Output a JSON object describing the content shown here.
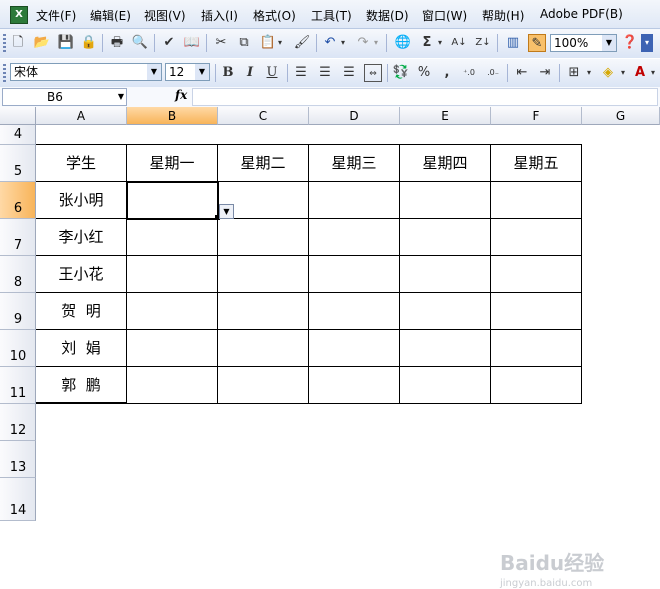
{
  "menubar": {
    "items": [
      "文件(F)",
      "编辑(E)",
      "视图(V)",
      "插入(I)",
      "格式(O)",
      "工具(T)",
      "数据(D)",
      "窗口(W)",
      "帮助(H)",
      "Adobe PDF(B)"
    ]
  },
  "toolbar": {
    "zoom_value": "100%",
    "icons": [
      "new-icon",
      "open-icon",
      "save-icon",
      "permission-icon",
      "print-icon",
      "print-preview-icon",
      "spelling-icon",
      "research-icon",
      "cut-icon",
      "copy-icon",
      "paste-icon",
      "format-painter-icon",
      "undo-icon",
      "redo-icon",
      "hyperlink-icon",
      "autosum-icon",
      "sort-ascending-icon",
      "sort-descending-icon",
      "chart-wizard-icon",
      "drawing-icon",
      "help-icon"
    ]
  },
  "format_toolbar": {
    "font_name": "宋体",
    "font_size": "12",
    "bold_label": "B",
    "italic_label": "I",
    "underline_label": "U",
    "percent_label": "%",
    "comma_label": ","
  },
  "formula_bar": {
    "name_box": "B6",
    "fx_label": "fx",
    "formula_value": ""
  },
  "sheet": {
    "columns": [
      "A",
      "B",
      "C",
      "D",
      "E",
      "F",
      "G"
    ],
    "selected_column": "B",
    "rows": [
      "4",
      "5",
      "6",
      "7",
      "8",
      "9",
      "10",
      "11",
      "12",
      "13",
      "14"
    ],
    "selected_row": "6",
    "header_row": [
      "学生",
      "星期一",
      "星期二",
      "星期三",
      "星期四",
      "星期五"
    ],
    "students": [
      "张小明",
      "李小红",
      "王小花",
      "贺  明",
      "刘  娟",
      "郭  鹏"
    ]
  },
  "colors": {
    "selection_header": "#f8b45a",
    "toolbar_bg": "#dbe5f5"
  },
  "watermark": {
    "brand": "Baidu经验",
    "url": "jingyan.baidu.com"
  }
}
